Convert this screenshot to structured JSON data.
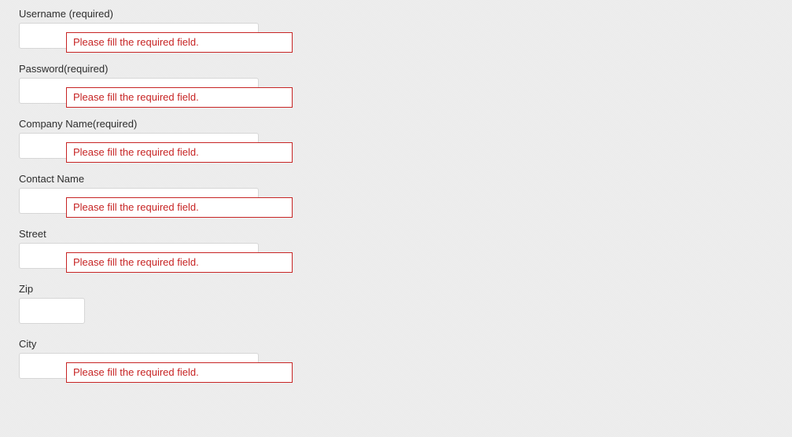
{
  "form": {
    "username": {
      "label": "Username (required)",
      "value": "",
      "error": "Please fill the required field."
    },
    "password": {
      "label": "Password(required)",
      "value": "",
      "error": "Please fill the required field."
    },
    "company": {
      "label": "Company Name(required)",
      "value": "",
      "error": "Please fill the required field."
    },
    "contact": {
      "label": "Contact Name",
      "value": "",
      "error": "Please fill the required field."
    },
    "street": {
      "label": "Street",
      "value": "",
      "error": "Please fill the required field."
    },
    "zip": {
      "label": "Zip",
      "value": ""
    },
    "city": {
      "label": "City",
      "value": "",
      "error": "Please fill the required field."
    }
  }
}
